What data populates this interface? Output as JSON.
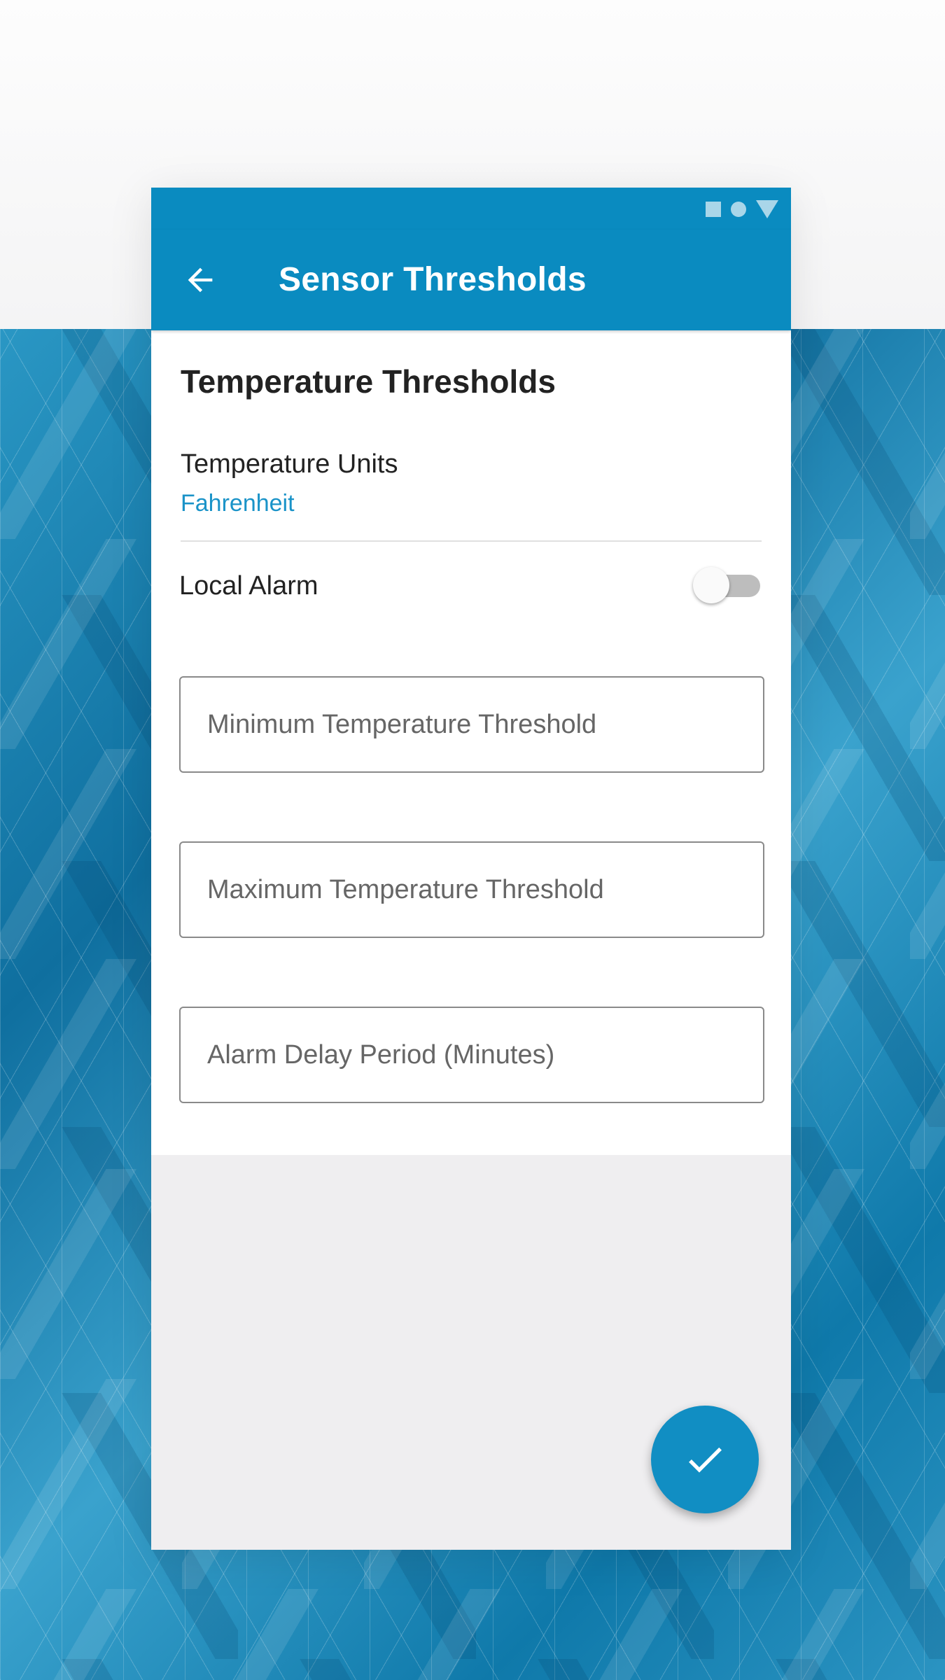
{
  "app_bar": {
    "title": "Sensor Thresholds",
    "back_icon": "arrow-back-icon",
    "color": "#0a8bc0"
  },
  "status_bar": {
    "icons": [
      "square-icon",
      "circle-icon",
      "triangle-icon"
    ]
  },
  "section": {
    "title": "Temperature Thresholds"
  },
  "units": {
    "label": "Temperature Units",
    "value": "Fahrenheit",
    "value_color": "#1a93c8"
  },
  "alarm": {
    "label": "Local Alarm",
    "enabled": false
  },
  "fields": {
    "min_placeholder": "Minimum Temperature Threshold",
    "max_placeholder": "Maximum Temperature Threshold",
    "delay_placeholder": "Alarm Delay Period (Minutes)",
    "min_value": "",
    "max_value": "",
    "delay_value": ""
  },
  "fab": {
    "icon": "check-icon",
    "color": "#118ec3"
  }
}
